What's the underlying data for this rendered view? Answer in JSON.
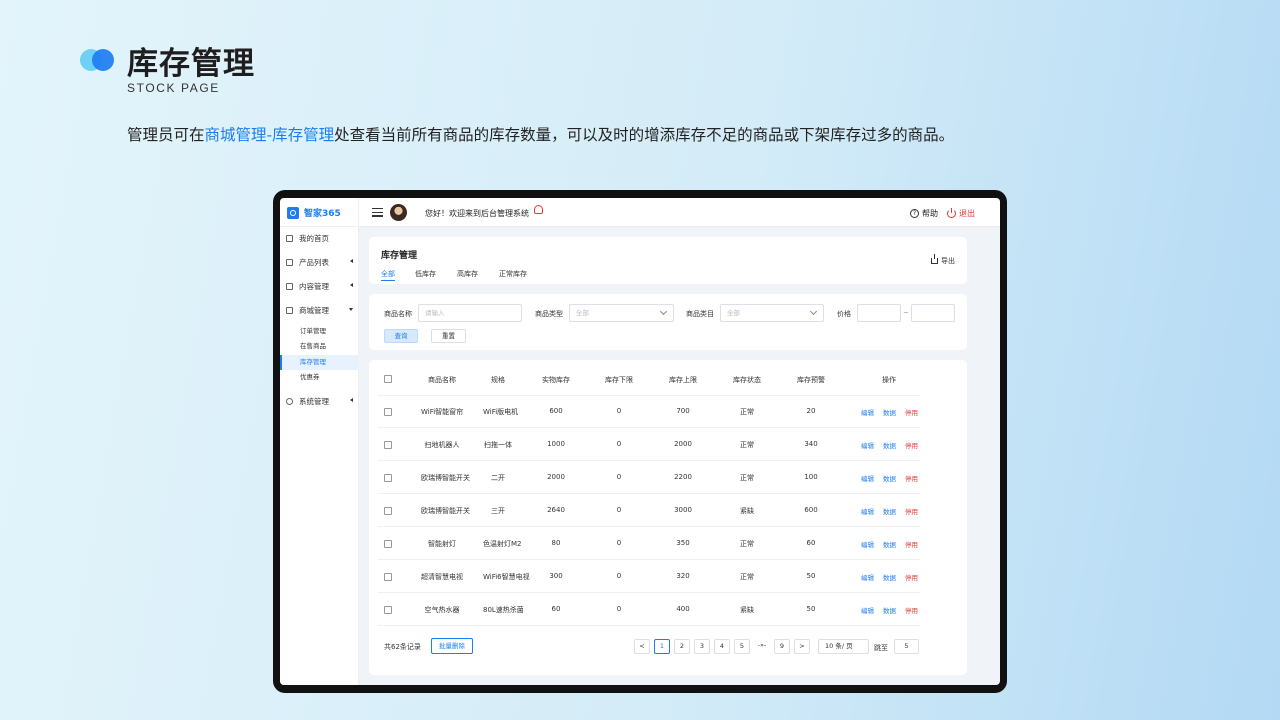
{
  "slide": {
    "title": "库存管理",
    "subtitle": "STOCK PAGE",
    "desc_prefix": "管理员可在",
    "desc_highlight": "商城管理-库存管理",
    "desc_suffix": "处查看当前所有商品的库存数量，可以及时的增添库存不足的商品或下架库存过多的商品。"
  },
  "app": {
    "brand": "智家365",
    "welcome": "您好！欢迎来到后台管理系统",
    "help": "帮助",
    "logout": "退出",
    "accent": "#1d7df0",
    "danger": "#e23a3a"
  },
  "sidebar": {
    "items": [
      {
        "label": "我的首页",
        "icon": "home-icon"
      },
      {
        "label": "产品列表",
        "icon": "grid-icon"
      },
      {
        "label": "内容管理",
        "icon": "document-icon"
      },
      {
        "label": "商城管理",
        "icon": "shop-icon"
      },
      {
        "label": "系统管理",
        "icon": "gear-icon"
      }
    ],
    "sub_items": [
      "订单管理",
      "在售商品",
      "库存管理",
      "优惠券"
    ]
  },
  "page": {
    "title": "库存管理",
    "tabs": [
      "全部",
      "低库存",
      "高库存",
      "正常库存"
    ],
    "export": "导出"
  },
  "filter": {
    "name_label": "商品名称",
    "name_placeholder": "请输入",
    "type_label": "商品类型",
    "type_value": "全部",
    "category_label": "商品类目",
    "category_value": "全部",
    "price_label": "价格",
    "price_sep": "~",
    "query": "查询",
    "reset": "重置"
  },
  "table": {
    "headers": [
      "商品名称",
      "规格",
      "实物库存",
      "库存下限",
      "库存上限",
      "库存状态",
      "库存预警",
      "操作"
    ],
    "rows": [
      [
        "WiFi智能窗帘",
        "WiFi版电机",
        "600",
        "0",
        "700",
        "正常",
        "20"
      ],
      [
        "扫地机器人",
        "扫拖一体",
        "1000",
        "0",
        "2000",
        "正常",
        "340"
      ],
      [
        "欧瑞博智能开关",
        "二开",
        "2000",
        "0",
        "2200",
        "正常",
        "100"
      ],
      [
        "欧瑞博智能开关",
        "三开",
        "2640",
        "0",
        "3000",
        "紧缺",
        "600"
      ],
      [
        "智能射灯",
        "色温射灯M2",
        "80",
        "0",
        "350",
        "正常",
        "60"
      ],
      [
        "超清智慧电视",
        "WiFi6智慧电视",
        "300",
        "0",
        "320",
        "正常",
        "50"
      ],
      [
        "空气热水器",
        "80L速热杀菌",
        "60",
        "0",
        "400",
        "紧缺",
        "50"
      ]
    ],
    "ops": [
      "编辑",
      "数据",
      "停用"
    ]
  },
  "footer": {
    "total": "共62条记录",
    "batch_delete": "批量删除",
    "prev": "<",
    "pages": [
      "1",
      "2",
      "3",
      "4",
      "5",
      "-»-",
      "9"
    ],
    "next": ">",
    "page_size": "10 条/ 页",
    "jump_label": "跳至",
    "jump_value": "5"
  }
}
